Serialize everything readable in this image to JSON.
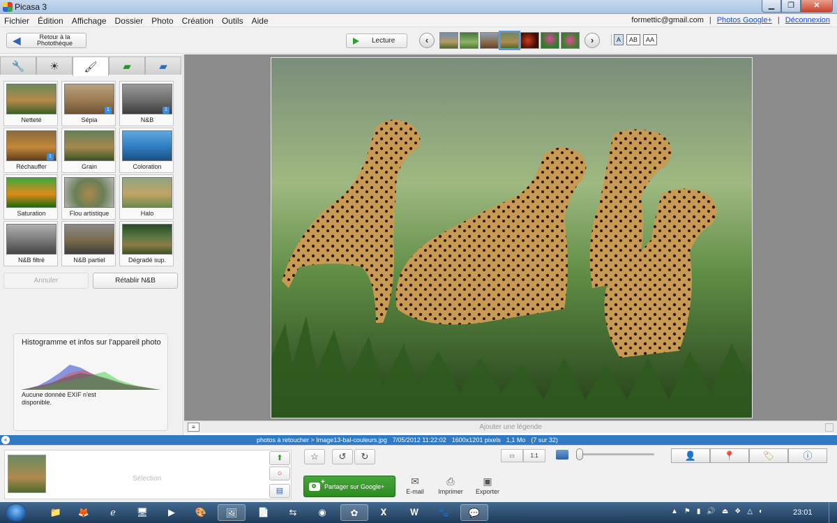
{
  "window": {
    "title": "Picasa 3"
  },
  "menu": {
    "items": [
      "Fichier",
      "Édition",
      "Affichage",
      "Dossier",
      "Photo",
      "Création",
      "Outils",
      "Aide"
    ],
    "account_email": "formettic@gmail.com",
    "separator": "|",
    "photos_google": "Photos Google+",
    "logout": "Déconnexion"
  },
  "toolbar": {
    "back_label": "Retour à la Photothèque",
    "play_label": "Lecture",
    "text_size_buttons": [
      "A",
      "AB",
      "AA"
    ]
  },
  "editing": {
    "tab_icons": [
      "wrench-icon",
      "sun-icon",
      "brush-icon",
      "green-brush-icon",
      "blue-brush-icon"
    ],
    "effects": [
      {
        "label": "Netteté",
        "badge": ""
      },
      {
        "label": "Sépia",
        "badge": "1"
      },
      {
        "label": "N&B",
        "badge": "1"
      },
      {
        "label": "Réchauffer",
        "badge": "1"
      },
      {
        "label": "Grain",
        "badge": ""
      },
      {
        "label": "Coloration",
        "badge": ""
      },
      {
        "label": "Saturation",
        "badge": ""
      },
      {
        "label": "Flou artistique",
        "badge": ""
      },
      {
        "label": "Halo",
        "badge": ""
      },
      {
        "label": "N&B filtré",
        "badge": ""
      },
      {
        "label": "N&B partiel",
        "badge": ""
      },
      {
        "label": "Dégradé sup.",
        "badge": ""
      }
    ],
    "undo_label": "Annuler",
    "redo_label": "Rétablir N&B",
    "histogram_title": "Histogramme et infos sur l'appareil photo",
    "exif_message": "Aucune donnée EXIF n'est disponible."
  },
  "viewer": {
    "caption_placeholder": "Ajouter une légende"
  },
  "status": {
    "path": "photos à retoucher > Image13-bal-couleurs.jpg",
    "date": "7/05/2012 11:22:02",
    "dimensions": "1600x1201 pixels",
    "size": "1,1 Mo",
    "position": "(7 sur 32)"
  },
  "tray": {
    "selection_label": "Sélection",
    "share_label": "Partager sur Google+",
    "email_label": "E-mail",
    "print_label": "Imprimer",
    "export_label": "Exporter",
    "view_buttons": [
      "▭",
      "1:1"
    ]
  },
  "taskbar": {
    "clock": "23:01"
  },
  "colors": {
    "status_blue": "#2f7ac3",
    "share_green": "#3a9a2f",
    "link_blue": "#1a4ed8"
  }
}
